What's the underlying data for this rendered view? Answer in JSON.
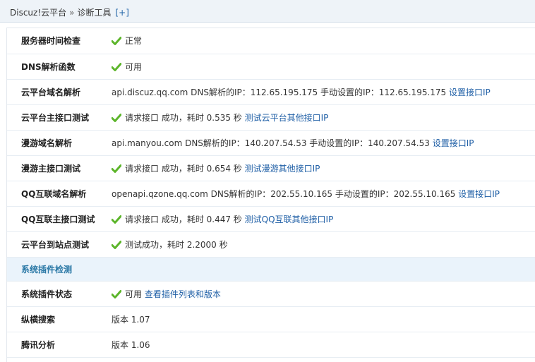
{
  "breadcrumb": {
    "root": "Discuz!云平台",
    "sep": "»",
    "current": "诊断工具",
    "toggle": "[+]"
  },
  "rows": [
    {
      "label": "服务器时间检查",
      "ok": true,
      "text": "正常",
      "link": ""
    },
    {
      "label": "DNS解析函数",
      "ok": true,
      "text": "可用",
      "link": ""
    },
    {
      "label": "云平台域名解析",
      "ok": false,
      "text": "api.discuz.qq.com DNS解析的IP：112.65.195.175 手动设置的IP：112.65.195.175",
      "link": "设置接口IP"
    },
    {
      "label": "云平台主接口测试",
      "ok": true,
      "text": "请求接口 成功，耗时 0.535 秒",
      "link": "测试云平台其他接口IP"
    },
    {
      "label": "漫游域名解析",
      "ok": false,
      "text": "api.manyou.com DNS解析的IP：140.207.54.53 手动设置的IP：140.207.54.53",
      "link": "设置接口IP"
    },
    {
      "label": "漫游主接口测试",
      "ok": true,
      "text": "请求接口 成功，耗时 0.654 秒",
      "link": "测试漫游其他接口IP"
    },
    {
      "label": "QQ互联域名解析",
      "ok": false,
      "text": "openapi.qzone.qq.com DNS解析的IP：202.55.10.165 手动设置的IP：202.55.10.165",
      "link": "设置接口IP"
    },
    {
      "label": "QQ互联主接口测试",
      "ok": true,
      "text": "请求接口 成功，耗时 0.447 秒",
      "link": "测试QQ互联其他接口IP"
    },
    {
      "label": "云平台到站点测试",
      "ok": true,
      "text": "测试成功，耗时 2.2000 秒",
      "link": ""
    }
  ],
  "section": {
    "title": "系统插件检测"
  },
  "plugin_rows": [
    {
      "label": "系统插件状态",
      "ok": true,
      "text": "可用",
      "link": "查看插件列表和版本"
    },
    {
      "label": "纵横搜索",
      "ok": false,
      "text": "版本 1.07",
      "link": ""
    },
    {
      "label": "腾讯分析",
      "ok": false,
      "text": "版本 1.06",
      "link": ""
    }
  ],
  "colors": {
    "ok_icon": "#5cb52a",
    "link": "#1f5fa6",
    "section": "#2a78a6"
  }
}
